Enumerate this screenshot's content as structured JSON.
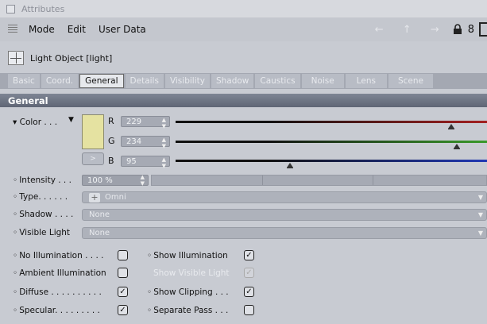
{
  "window": {
    "title": "Attributes"
  },
  "menu": {
    "items": [
      "Mode",
      "Edit",
      "User Data"
    ],
    "arrows": "← ↑ →",
    "right_num": "8"
  },
  "object": {
    "title": "Light Object [light]"
  },
  "tabs": [
    "Basic",
    "Coord.",
    "General",
    "Details",
    "Visibility",
    "Shadow",
    "Caustics",
    "Noise",
    "Lens",
    "Scene"
  ],
  "active_tab": "General",
  "section": {
    "title": "General"
  },
  "color": {
    "label": "Color . . .",
    "swatch_color": "#e5e2a1",
    "toggle_label": ">",
    "channels": [
      {
        "name": "R",
        "value": "229",
        "fraction": 0.898,
        "color": "#a32020"
      },
      {
        "name": "G",
        "value": "234",
        "fraction": 0.918,
        "color": "#3a9a2a"
      },
      {
        "name": "B",
        "value": "95",
        "fraction": 0.373,
        "color": "#2038b4"
      }
    ]
  },
  "intensity": {
    "label": "Intensity . . .",
    "value": "100 %",
    "fraction": 1.0
  },
  "type": {
    "label": "Type. . . . . .",
    "value": "Omni"
  },
  "shadow": {
    "label": "Shadow . . . .",
    "value": "None"
  },
  "visible_light": {
    "label": "Visible Light",
    "value": "None"
  },
  "checkboxes": {
    "no_illumination": {
      "label": "No Illumination . . . .",
      "checked": false
    },
    "ambient_illumination": {
      "label": "Ambient Illumination",
      "checked": false
    },
    "diffuse": {
      "label": "Diffuse . . . . . . . . . .",
      "checked": true
    },
    "specular": {
      "label": "Specular. . . . . . . . .",
      "checked": true
    },
    "show_illumination": {
      "label": "Show Illumination",
      "checked": true
    },
    "show_visible_light": {
      "label": "Show Visible Light",
      "checked": true,
      "disabled": true
    },
    "show_clipping": {
      "label": "Show Clipping . . .",
      "checked": true
    },
    "separate_pass": {
      "label": "Separate Pass . . .",
      "checked": false
    }
  }
}
